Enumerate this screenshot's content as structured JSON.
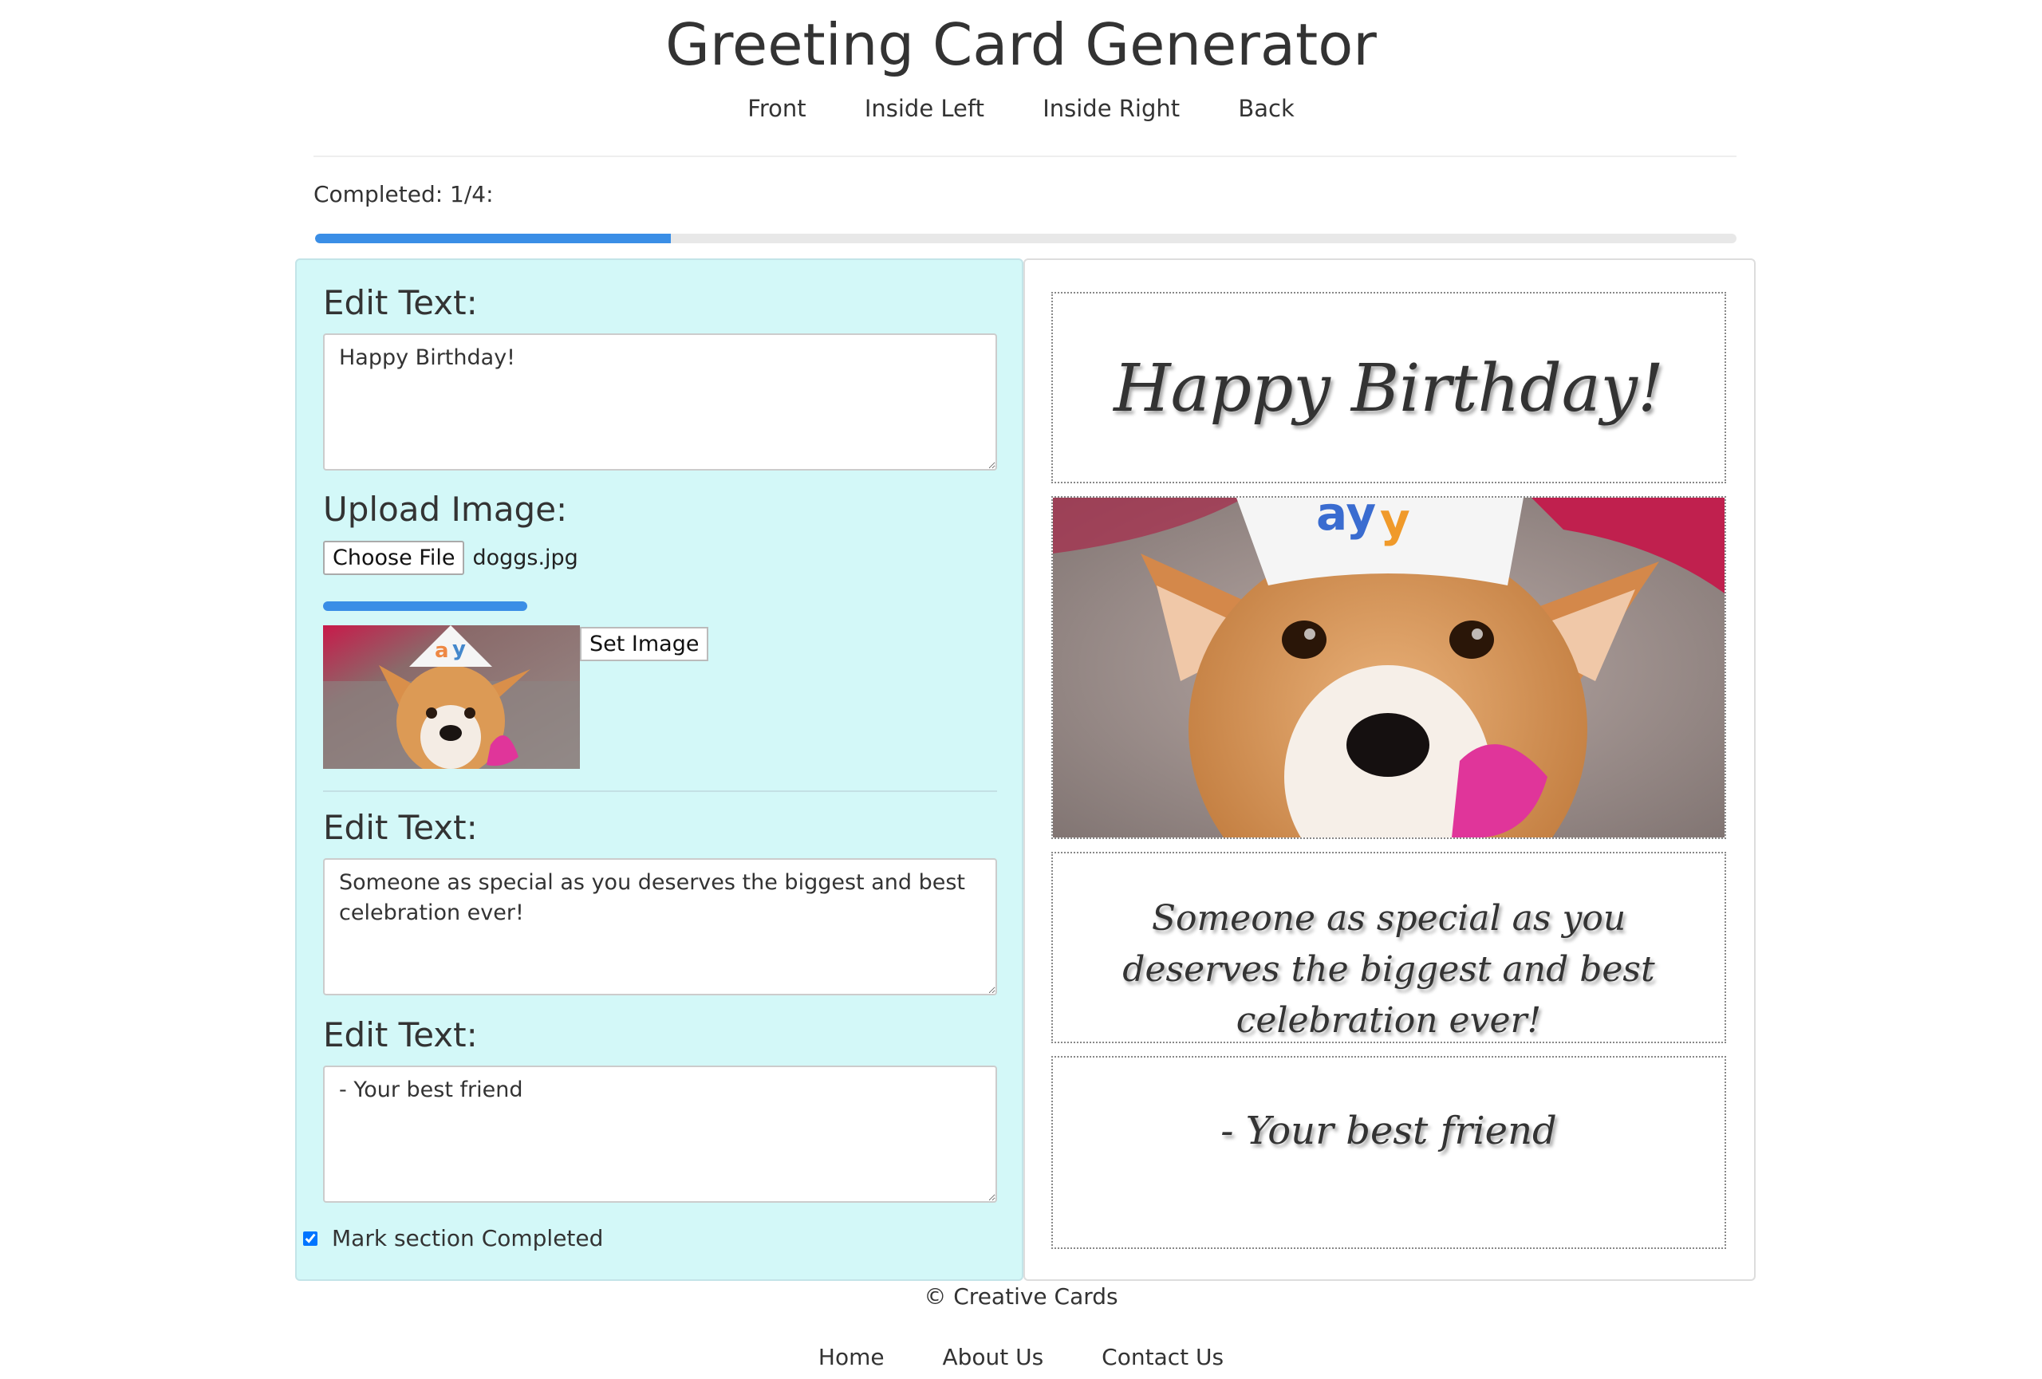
{
  "header": {
    "title": "Greeting Card Generator",
    "tabs": [
      "Front",
      "Inside Left",
      "Inside Right",
      "Back"
    ]
  },
  "progress": {
    "label": "Completed: 1/4:",
    "fraction": 0.25
  },
  "editor": {
    "edit_text_heading_1": "Edit Text:",
    "text_1": "Happy Birthday!",
    "upload_heading": "Upload Image:",
    "choose_file_label": "Choose File",
    "file_name": "doggs.jpg",
    "upload_progress": 1.0,
    "set_image_label": "Set Image",
    "edit_text_heading_2": "Edit Text:",
    "text_2": "Someone as special as you deserves the biggest and best celebration ever!",
    "edit_text_heading_3": "Edit Text:",
    "text_3": "- Your best friend",
    "mark_completed_label": "Mark section Completed",
    "mark_completed_checked": true
  },
  "preview": {
    "line_1": "Happy Birthday!",
    "line_2": "Someone as special as you deserves the biggest and best celebration ever!",
    "line_3": "- Your best friend"
  },
  "footer": {
    "copyright": "© Creative Cards",
    "links": [
      "Home",
      "About Us",
      "Contact Us"
    ]
  },
  "colors": {
    "panel_bg": "#d3f8f8",
    "accent": "#3a8ee6"
  }
}
